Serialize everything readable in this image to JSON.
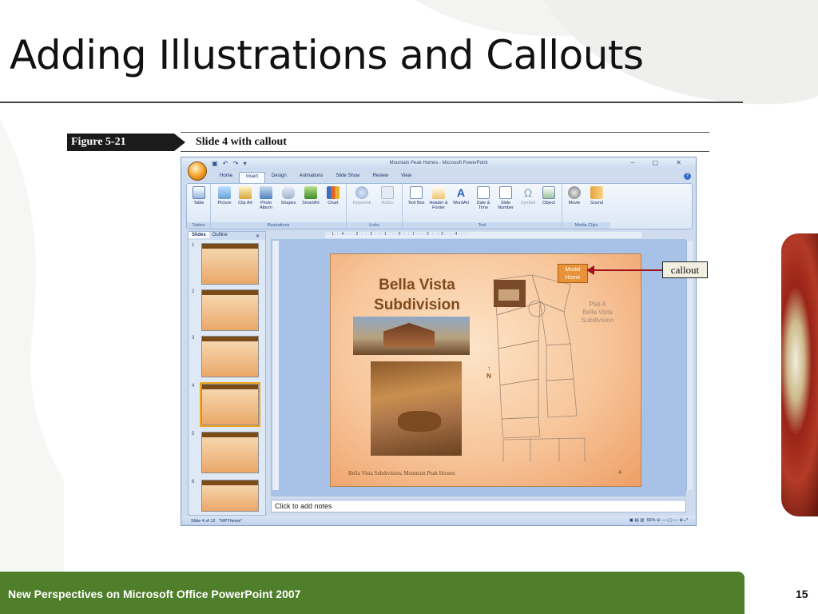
{
  "slide": {
    "title": "Adding Illustrations and Callouts",
    "footer_text": "New Perspectives on Microsoft Office PowerPoint 2007",
    "page_number": "15"
  },
  "figure": {
    "label": "Figure 5-21",
    "caption": "Slide 4 with callout",
    "callout_label": "callout"
  },
  "window": {
    "title": "Mountain Peak Homes - Microsoft PowerPoint",
    "tabs": [
      "Home",
      "Insert",
      "Design",
      "Animations",
      "Slide Show",
      "Review",
      "View"
    ],
    "active_tab": "Insert",
    "ribbon_groups": [
      {
        "label": "Tables",
        "buttons": [
          "Table"
        ]
      },
      {
        "label": "Illustrations",
        "buttons": [
          "Picture",
          "Clip Art",
          "Photo Album",
          "Shapes",
          "SmartArt",
          "Chart"
        ]
      },
      {
        "label": "Links",
        "buttons": [
          "Hyperlink",
          "Action"
        ]
      },
      {
        "label": "Text",
        "buttons": [
          "Text Box",
          "Header & Footer",
          "WordArt",
          "Date & Time",
          "Slide Number",
          "Symbol",
          "Object"
        ]
      },
      {
        "label": "Media Clips",
        "buttons": [
          "Movie",
          "Sound"
        ]
      }
    ],
    "panel_tabs": [
      "Slides",
      "Outline"
    ],
    "thumbnails": [
      {
        "num": "1"
      },
      {
        "num": "2"
      },
      {
        "num": "3"
      },
      {
        "num": "4"
      },
      {
        "num": "5"
      },
      {
        "num": "6"
      }
    ],
    "notes_placeholder": "Click to add notes",
    "status": {
      "slide_of": "Slide 4 of 12",
      "theme": "\"MPTheme\"",
      "zoom": "66%"
    }
  },
  "slide_content": {
    "title_line1": "Bella Vista",
    "title_line2": "Subdivision",
    "plat_label": "Plat A\nBella Vista\nSubdivision",
    "compass": "N",
    "model_home_line1": "Model",
    "model_home_line2": "Home",
    "footer": "Bella Vista Subdivision, Mountain Peak Homes",
    "number": "4"
  },
  "colors": {
    "footer_bar": "#4f7f2a",
    "slide_title": "#7f4a1d",
    "callout_arrow": "#a2121a",
    "model_home": "#e89239"
  }
}
